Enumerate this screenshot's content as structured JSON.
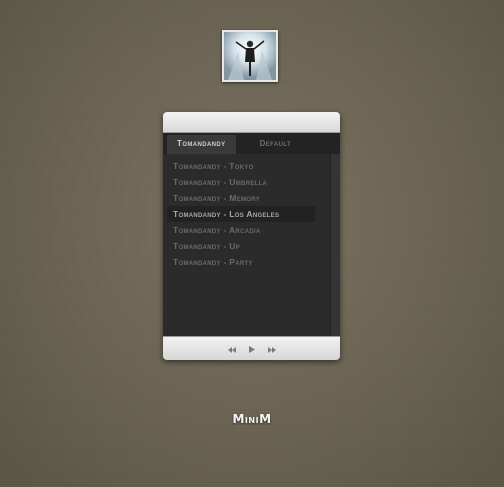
{
  "album": {
    "icon": "album-cover-image"
  },
  "tabs": [
    {
      "label": "Tomandandy",
      "active": true
    },
    {
      "label": "Default",
      "active": false
    }
  ],
  "playlist": {
    "items": [
      "Tomandandy - Tokyo",
      "Tomandandy - Umbrella",
      "Tomandandy - Memory",
      "Tomandandy - Los Angeles",
      "Tomandandy - Arcadia",
      "Tomandandy - Up",
      "Tomandandy - Party"
    ],
    "selected_index": 3
  },
  "controls": {
    "previous": "rewind-icon",
    "play": "play-icon",
    "next": "fast-forward-icon"
  },
  "brand": "MiniM",
  "colors": {
    "background": "#6a6352",
    "panel": "#2a2a2a",
    "chrome": "#e0e0e0"
  }
}
